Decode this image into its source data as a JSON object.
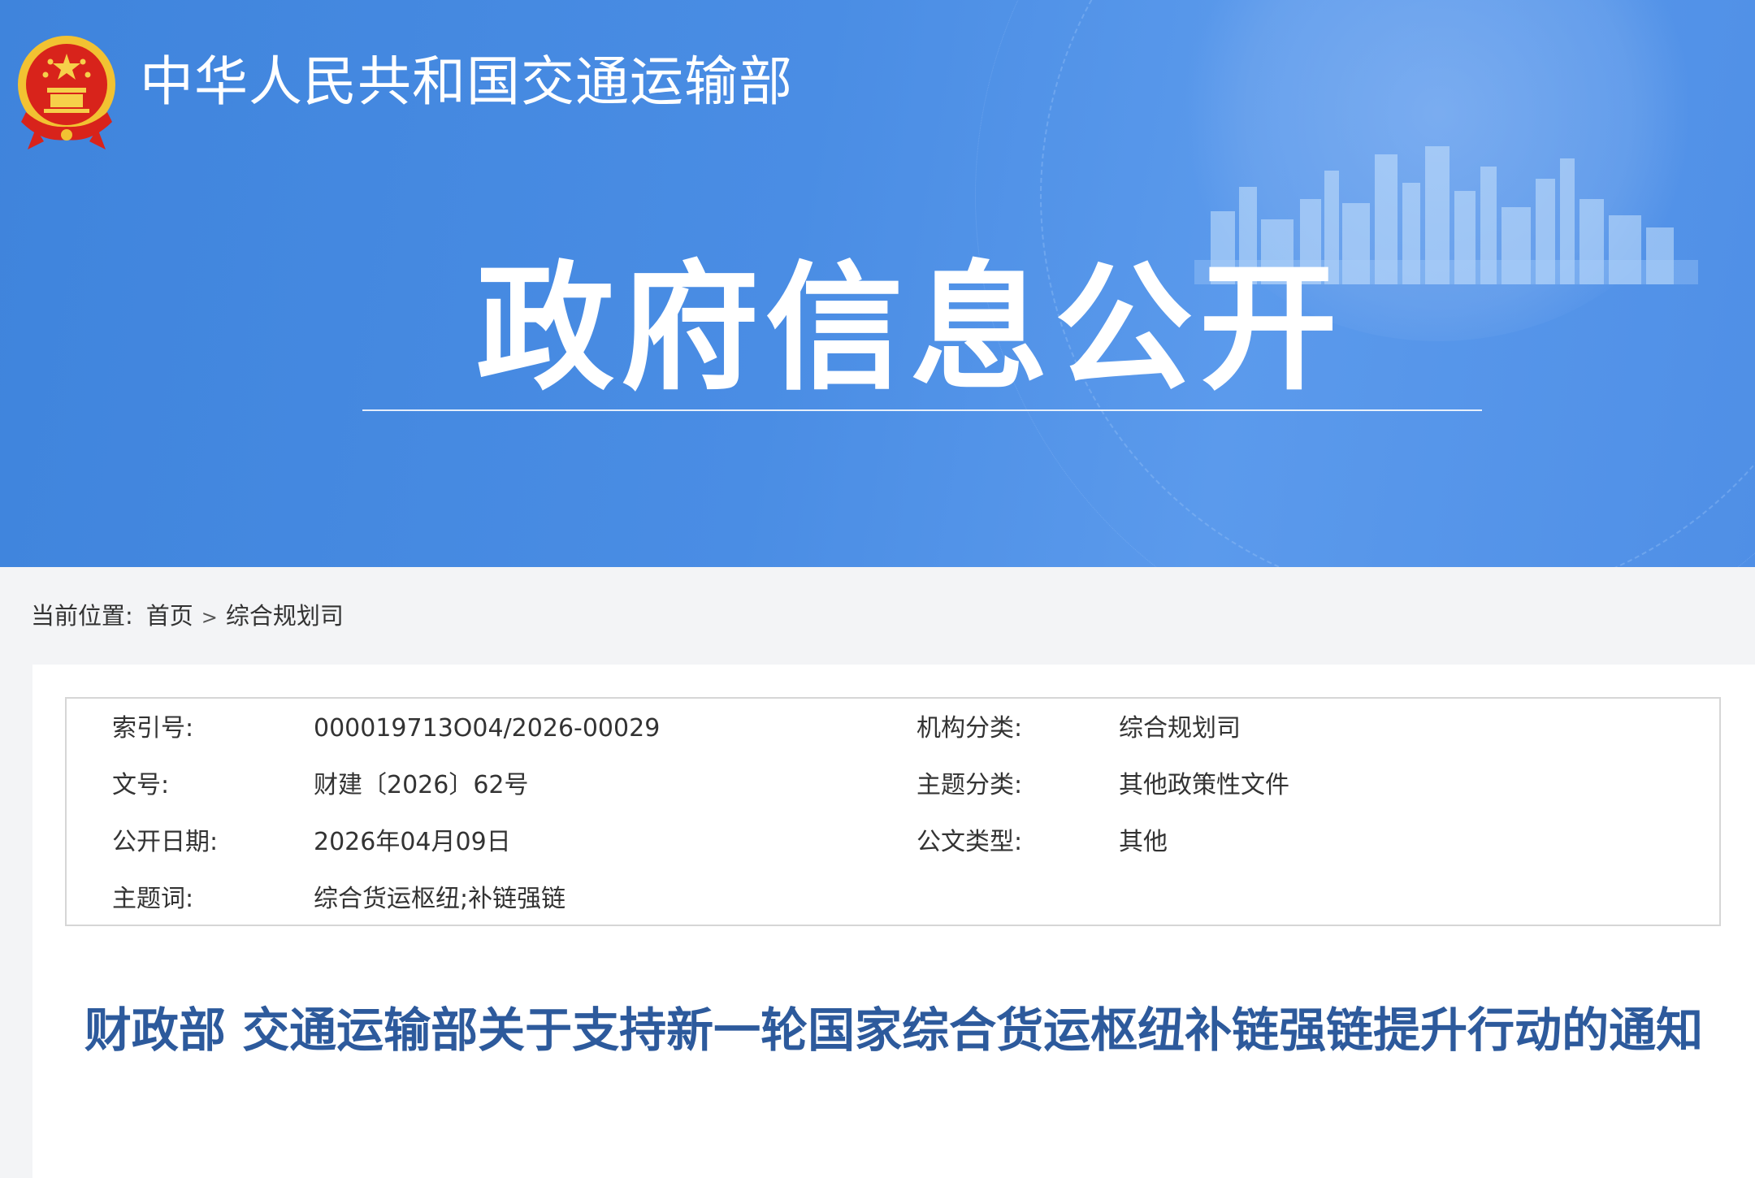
{
  "header": {
    "ministry_name": "中华人民共和国交通运输部",
    "section_title": "政府信息公开"
  },
  "breadcrumb": {
    "prefix": "当前位置:",
    "items": [
      "首页",
      "综合规划司"
    ],
    "separator": ">"
  },
  "metadata": {
    "rows": [
      {
        "label_left": "索引号:",
        "value_left": "000019713O04/2026-00029",
        "label_right": "机构分类:",
        "value_right": "综合规划司"
      },
      {
        "label_left": "文号:",
        "value_left": "财建〔2026〕62号",
        "label_right": "主题分类:",
        "value_right": "其他政策性文件"
      },
      {
        "label_left": "公开日期:",
        "value_left": "2026年04月09日",
        "label_right": "公文类型:",
        "value_right": "其他"
      },
      {
        "label_left": "主题词:",
        "value_left": "综合货运枢纽;补链强链",
        "label_right": "",
        "value_right": ""
      }
    ]
  },
  "document": {
    "title": "财政部 交通运输部关于支持新一轮国家综合货运枢纽补链强链提升行动的通知"
  },
  "colors": {
    "banner_blue": "#4a8de4",
    "title_blue": "#2d5a9c",
    "emblem_red": "#d8231b",
    "emblem_gold": "#f2c232"
  },
  "icons": {
    "emblem": "national-emblem-icon"
  }
}
